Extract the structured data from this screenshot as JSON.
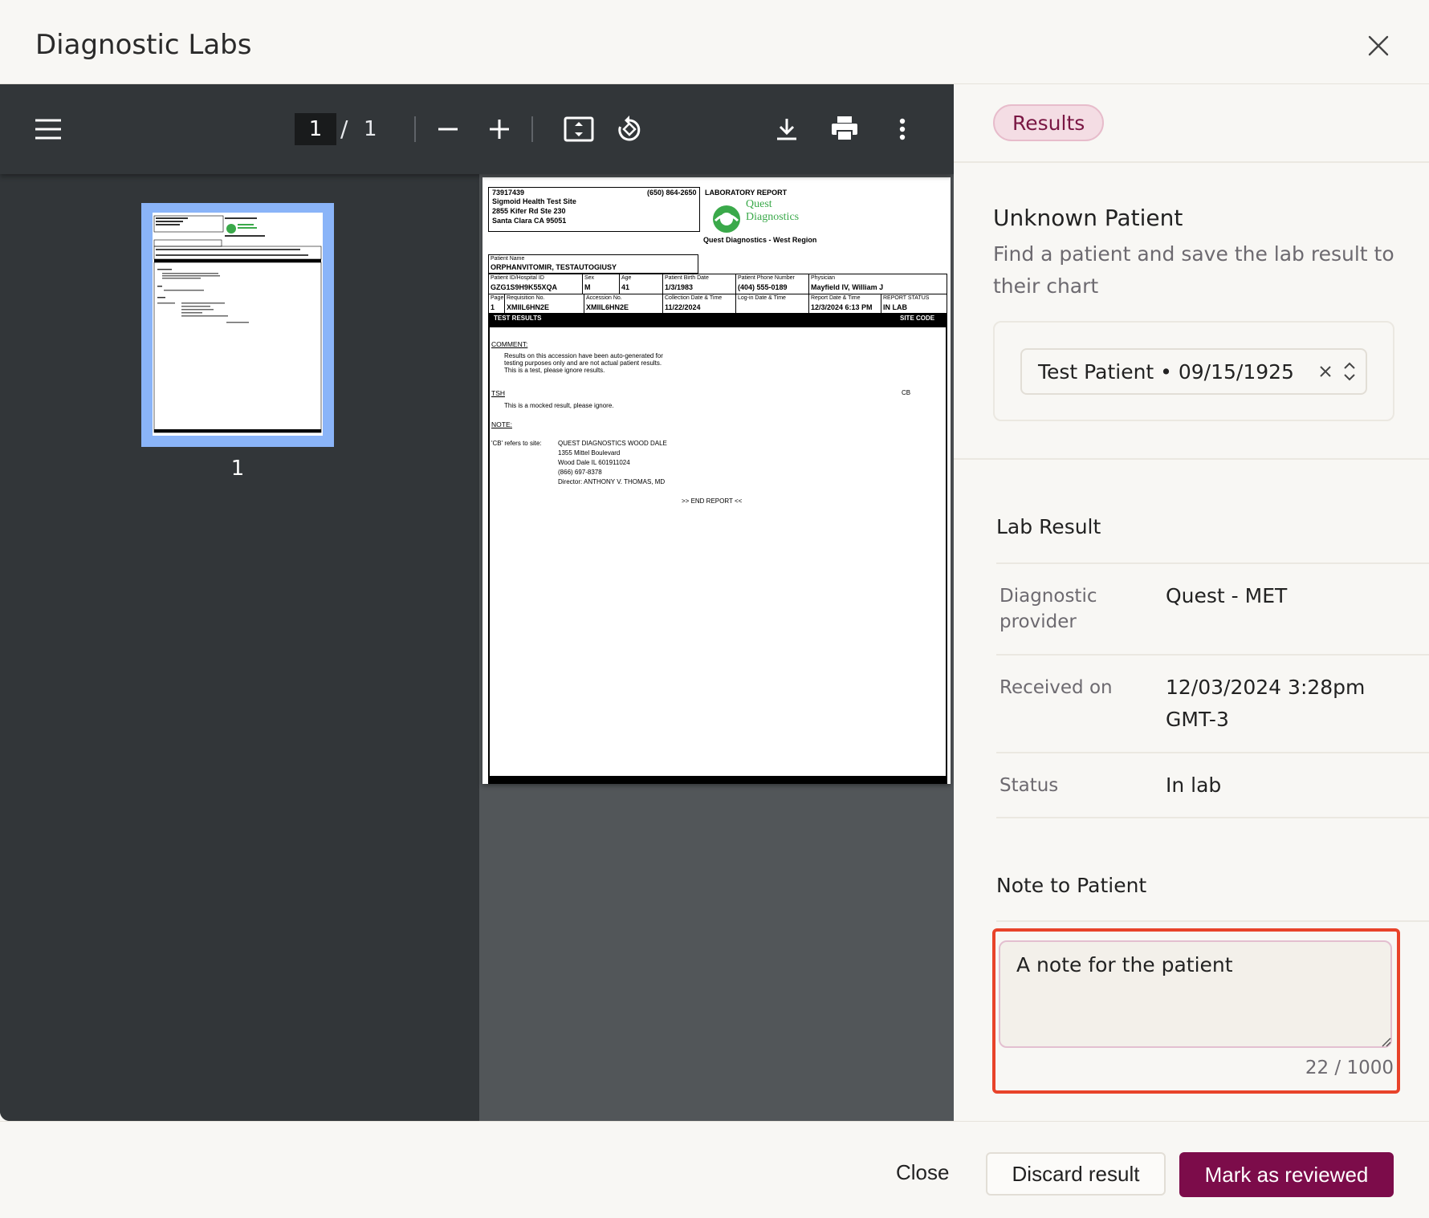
{
  "header": {
    "title": "Diagnostic Labs"
  },
  "viewer": {
    "page_current": "1",
    "page_separator": "/",
    "page_total": "1",
    "thumbnail_label": "1"
  },
  "document": {
    "site_id": "73917439",
    "site_phone": "(650) 864-2650",
    "site_name": "Sigmoid Health Test Site",
    "site_addr1": "2855 Kifer Rd Ste 230",
    "site_addr2": "Santa Clara CA 95051",
    "report_title": "LABORATORY REPORT",
    "logo_line1": "Quest",
    "logo_line2": "Diagnostics",
    "region": "Quest Diagnostics - West Region",
    "patient_name_label": "Patient Name",
    "patient_name": "ORPHANVITOMIR, TESTAUTOGIUSY",
    "row1": [
      {
        "label": "Patient ID/Hospital ID",
        "value": "GZG1S9H9K55XQA"
      },
      {
        "label": "Sex",
        "value": "M"
      },
      {
        "label": "Age",
        "value": "41"
      },
      {
        "label": "Patient Birth Date",
        "value": "1/3/1983"
      },
      {
        "label": "Patient Phone Number",
        "value": "(404) 555-0189"
      },
      {
        "label": "Physician",
        "value": "Mayfield IV, William J"
      }
    ],
    "row2": [
      {
        "label": "Page",
        "value": "1"
      },
      {
        "label": "Requisition No.",
        "value": "XMIIL6HN2E"
      },
      {
        "label": "Accession No.",
        "value": "XMIIL6HN2E"
      },
      {
        "label": "Collection Date & Time",
        "value": "11/22/2024"
      },
      {
        "label": "Log-in Date & Time",
        "value": ""
      },
      {
        "label": "Report Date & Time",
        "value": "12/3/2024  6:13 PM"
      },
      {
        "label": "REPORT STATUS",
        "value": "IN LAB"
      }
    ],
    "test_results_header": "TEST RESULTS",
    "site_code_header": "SITE CODE",
    "comment_heading": "COMMENT:",
    "comment_lines": [
      "Results on this accession have been auto-generated for",
      "testing purposes only and are not actual patient results.",
      "This is a test, please ignore results."
    ],
    "tsh_heading": "TSH",
    "tsh_site": "CB",
    "tsh_text": "This is a mocked result, please ignore.",
    "note_heading": "NOTE:",
    "cb_refers": "'CB' refers to site:",
    "site_lines": [
      "QUEST DIAGNOSTICS WOOD DALE",
      "1355 Mittel Boulevard",
      "Wood Dale IL 601911024",
      "(866) 697-8378",
      "Director: ANTHONY V. THOMAS, MD"
    ],
    "end_report": ">> END REPORT <<"
  },
  "side": {
    "badge": "Results",
    "patient_title": "Unknown Patient",
    "patient_subtitle": "Find a patient and save the lab result to their chart",
    "patient_select_value": "Test Patient • 09/15/1925",
    "lab_result_title": "Lab Result",
    "fields": [
      {
        "label": "Diagnostic provider",
        "value": "Quest - MET"
      },
      {
        "label": "Received on",
        "value": "12/03/2024 3:28pm GMT-3"
      },
      {
        "label": "Status",
        "value": "In lab"
      }
    ],
    "note_title": "Note to Patient",
    "note_value": "A note for the patient",
    "note_count": "22 / 1000"
  },
  "footer": {
    "close_label": "Close",
    "discard_label": "Discard result",
    "review_label": "Mark as reviewed"
  },
  "colors": {
    "primary": "#7c0c4a",
    "badge_bg": "#f4dde4",
    "focus_outline": "#e8432a",
    "viewer_bg": "#323639"
  },
  "icons": [
    "close-icon",
    "menu-icon",
    "zoom-out-icon",
    "zoom-in-icon",
    "fit-page-icon",
    "rotate-icon",
    "download-icon",
    "print-icon",
    "more-vert-icon",
    "clear-icon",
    "chevron-updown-icon",
    "resize-handle-icon"
  ]
}
